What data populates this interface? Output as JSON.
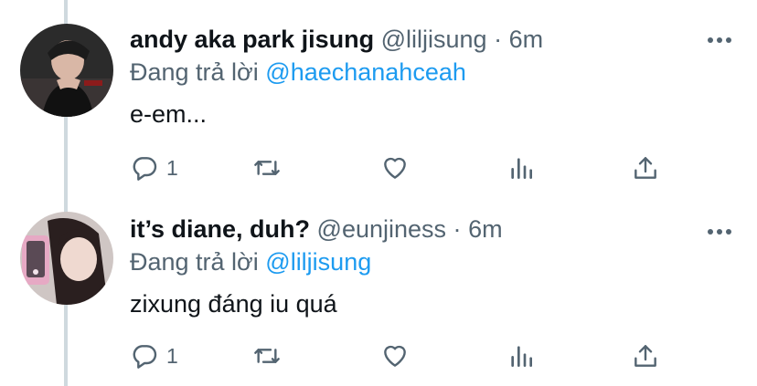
{
  "colors": {
    "link": "#1d9bf0",
    "muted": "#536471",
    "text": "#0f1419",
    "thread_line": "#cfd9de"
  },
  "tweets": [
    {
      "display_name": "andy aka park jisung",
      "handle": "@liljisung",
      "separator": "·",
      "time": "6m",
      "reply_prefix": "Đang trả lời",
      "reply_to": "@haechanahceah",
      "text": "e-em...",
      "reply_count": "1"
    },
    {
      "display_name": "it’s diane, duh?",
      "handle": "@eunjiness",
      "separator": "·",
      "time": "6m",
      "reply_prefix": "Đang trả lời",
      "reply_to": "@liljisung",
      "text": "zixung đáng iu quá",
      "reply_count": "1"
    }
  ],
  "icons": [
    "reply-icon",
    "retweet-icon",
    "like-icon",
    "analytics-icon",
    "share-icon",
    "more-icon"
  ]
}
